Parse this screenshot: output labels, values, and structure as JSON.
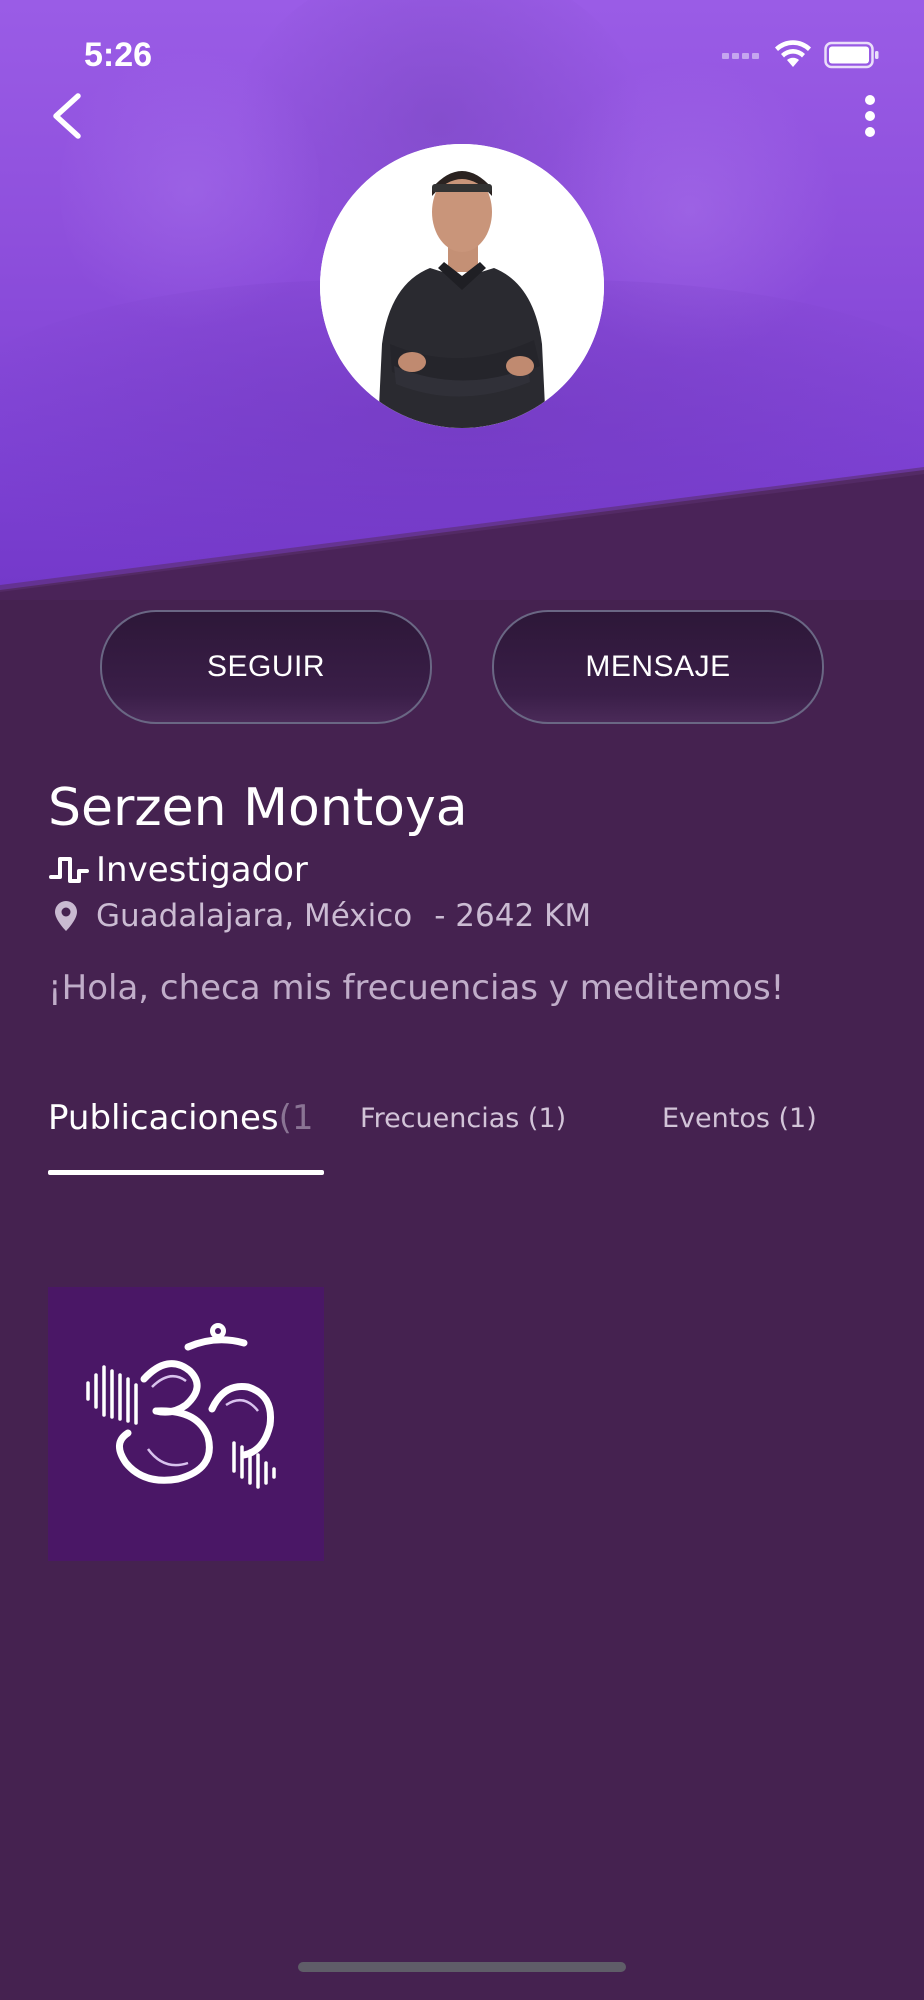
{
  "status_bar": {
    "time": "5:26"
  },
  "colors": {
    "cover_top": "#9a5ce6",
    "cover_bottom": "#7338c9",
    "background": "#452250",
    "slant_panel": "#4a2358",
    "button_border": "#6a6784",
    "thumb_bg": "#4a1766"
  },
  "header": {
    "back_icon": "chevron-left-icon",
    "menu_icon": "more-vertical-icon"
  },
  "actions": {
    "follow_label": "SEGUIR",
    "message_label": "MENSAJE"
  },
  "profile": {
    "name": "Serzen Montoya",
    "role": "Investigador",
    "role_icon": "square-wave-icon",
    "location": "Guadalajara, México",
    "distance": "- 2642 KM",
    "location_icon": "location-pin-icon",
    "bio": "¡Hola, checa mis frecuencias y meditemos!"
  },
  "tabs": [
    {
      "label_main": "Publicaciones",
      "label_fade": " (1",
      "active": true
    },
    {
      "label": "Frecuencias (1)",
      "active": false
    },
    {
      "label": "Eventos (1)",
      "active": false
    }
  ],
  "posts": [
    {
      "icon": "om-symbol-icon"
    }
  ]
}
